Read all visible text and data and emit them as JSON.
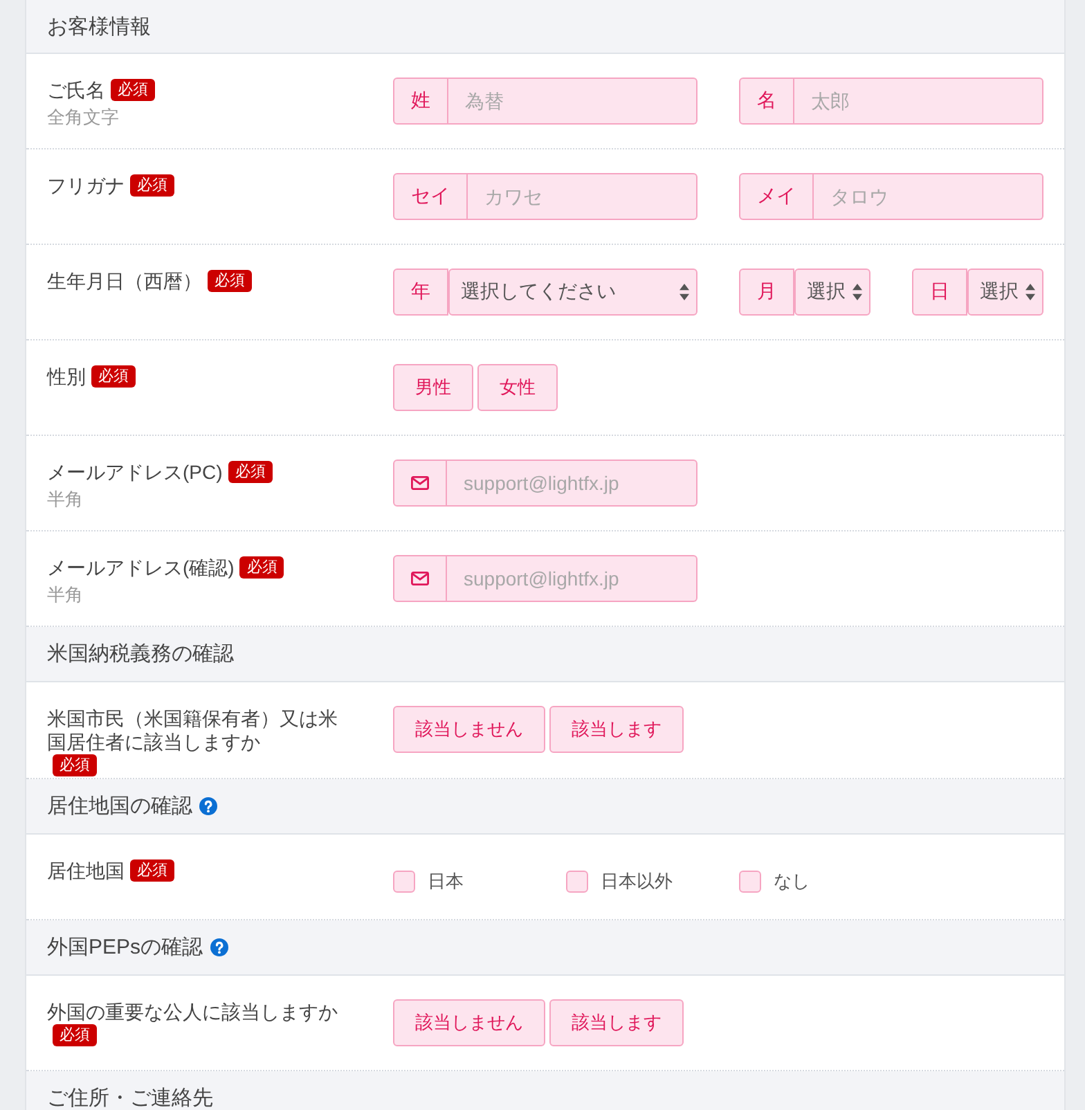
{
  "sections": [
    {
      "title": "お客様情報",
      "help": false,
      "rows": [
        {
          "kind": "pair",
          "label": "ご氏名",
          "badge": "必須",
          "note": "全角文字",
          "fields": [
            {
              "kind": "text",
              "addon": "姓",
              "placeholder": "為替"
            },
            {
              "kind": "text",
              "addon": "名",
              "placeholder": "太郎"
            }
          ]
        },
        {
          "kind": "pair",
          "label": "フリガナ",
          "badge": "必須",
          "fields": [
            {
              "kind": "text",
              "addon": "セイ",
              "placeholder": "カワセ"
            },
            {
              "kind": "text",
              "addon": "メイ",
              "placeholder": "タロウ"
            }
          ]
        },
        {
          "kind": "date",
          "label": "生年月日（西暦）",
          "badge": "必須",
          "fields": [
            {
              "kind": "select",
              "addon": "年",
              "value": "選択してください"
            },
            {
              "kind": "select",
              "addon": "月",
              "value": "選択"
            },
            {
              "kind": "select",
              "addon": "日",
              "value": "選択"
            }
          ]
        },
        {
          "kind": "choices",
          "label": "性別",
          "badge": "必須",
          "options": [
            {
              "label": "男性",
              "selected": false
            },
            {
              "label": "女性",
              "selected": false
            }
          ]
        },
        {
          "kind": "pair",
          "label": "メールアドレス(PC)",
          "badge": "必須",
          "note": "半角",
          "fields": [
            {
              "kind": "email",
              "placeholder": "support@lightfx.jp"
            }
          ]
        },
        {
          "kind": "pair",
          "label": "メールアドレス(確認)",
          "badge": "必須",
          "note": "半角",
          "fields": [
            {
              "kind": "email",
              "placeholder": "support@lightfx.jp"
            }
          ]
        }
      ]
    },
    {
      "title": "米国納税義務の確認",
      "help": false,
      "rows": [
        {
          "kind": "choices",
          "label": "米国市民（米国籍保有者）又は米国居住者に該当しますか",
          "badge": "必須",
          "options": [
            {
              "label": "該当しません",
              "selected": false
            },
            {
              "label": "該当します",
              "selected": false
            }
          ]
        }
      ]
    },
    {
      "title": "居住地国の確認",
      "help": true,
      "rows": [
        {
          "kind": "checks",
          "label": "居住地国",
          "badge": "必須",
          "options": [
            {
              "label": "日本",
              "checked": false
            },
            {
              "label": "日本以外",
              "checked": false
            },
            {
              "label": "なし",
              "checked": false
            }
          ]
        }
      ]
    },
    {
      "title": "外国PEPsの確認",
      "help": true,
      "rows": [
        {
          "kind": "choices",
          "label": "外国の重要な公人に該当しますか",
          "badge": "必須",
          "options": [
            {
              "label": "該当しません",
              "selected": false
            },
            {
              "label": "該当します",
              "selected": false
            }
          ]
        }
      ]
    },
    {
      "title": "ご住所・ご連絡先",
      "help": false
    }
  ]
}
